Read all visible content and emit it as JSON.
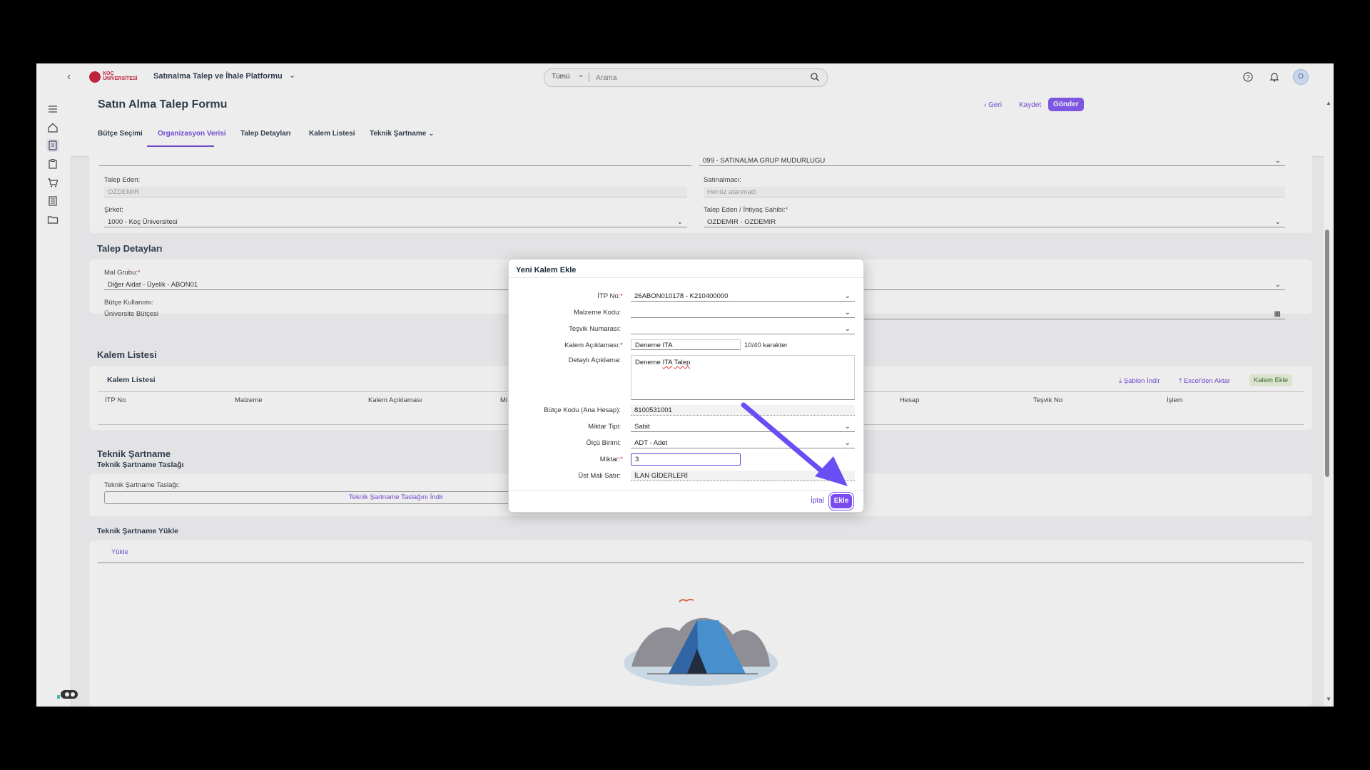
{
  "shell": {
    "logo_text": "KOÇ ÜNİVERSİTESİ",
    "app_title": "Satınalma Talep ve İhale Platformu",
    "search_scope": "Tümü",
    "search_placeholder": "Arama",
    "avatar_initial": "O"
  },
  "page": {
    "title": "Satın Alma Talep Formu",
    "back_label": "Geri",
    "save_label": "Kaydet",
    "send_label": "Gönder",
    "tabs": [
      {
        "label": "Bütçe Seçimi"
      },
      {
        "label": "Organizasyon Verisi"
      },
      {
        "label": "Talep Detayları"
      },
      {
        "label": "Kalem Listesi"
      },
      {
        "label": "Teknik Şartname"
      }
    ]
  },
  "org": {
    "purchasing_group_value": "099 - SATINALMA GRUP MUDURLUGU",
    "requester_label": "Talep Eden:",
    "requester_value": "OZDEMIR",
    "buyer_label": "Satınalmacı:",
    "buyer_value": "Henüz atanmadı",
    "company_label": "Şirket:",
    "company_value": "1000 - Koç Üniversitesi",
    "owner_label": "Talep Eden / İhtiyaç Sahibi:",
    "owner_value": "OZDEMIR - OZDEMIR"
  },
  "details": {
    "section_title": "Talep Detayları",
    "material_group_label": "Mal Grubu:",
    "material_group_value": "Diğer Aidat - Üyelik - ABON01",
    "budget_usage_label": "Bütçe Kullanımı:",
    "budget_usage_value": "Üniversite Bütçesi"
  },
  "items": {
    "section_title": "Kalem Listesi",
    "card_title": "Kalem Listesi",
    "template_download": "Şablon İndir",
    "excel_import": "Excel'den Aktar",
    "add_item": "Kalem Ekle",
    "columns": [
      "İTP No",
      "Malzeme",
      "Kalem Açıklaması",
      "Mi",
      "Hesap",
      "Teşvik No",
      "İşlem"
    ]
  },
  "spec": {
    "section_title": "Teknik Şartname",
    "draft_subtitle": "Teknik Şartname Taslağı",
    "draft_label": "Teknik Şartname Taslağı:",
    "draft_download": "Teknik Şartname Taslağını İndir",
    "upload_subtitle": "Teknik Şartname Yükle",
    "upload_tab": "Yükle"
  },
  "dialog": {
    "title": "Yeni Kalem Ekle",
    "fields": {
      "itp_label": "İTP No:",
      "itp_value": "26ABON010178 - K210400000",
      "material_code_label": "Malzeme Kodu:",
      "material_code_value": "",
      "incentive_label": "Teşvik Numarası:",
      "incentive_value": "",
      "item_desc_label": "Kalem Açıklaması:",
      "item_desc_value": "Deneme ITA",
      "item_desc_counter": "10/40 karakter",
      "detail_desc_label": "Detaylı Açıklama:",
      "detail_desc_value_a": "Deneme",
      "detail_desc_value_b": "ITA",
      "detail_desc_value_c": "Talep",
      "budget_code_label": "Bütçe Kodu (Ana Hesap):",
      "budget_code_value": "8100531001",
      "quantity_type_label": "Miktar Tipi:",
      "quantity_type_value": "Sabit",
      "unit_label": "Ölçü Birimi:",
      "unit_value": "ADT - Adet",
      "quantity_label": "Miktar:",
      "quantity_value": "3",
      "parent_line_label": "Üst Mali Satır:",
      "parent_line_value": "İLAN GİDERLERİ"
    },
    "cancel_label": "İptal",
    "add_label": "Ekle"
  },
  "colors": {
    "accent": "#7a4cf0",
    "link": "#6a3fd6",
    "brand": "#c8102e"
  }
}
